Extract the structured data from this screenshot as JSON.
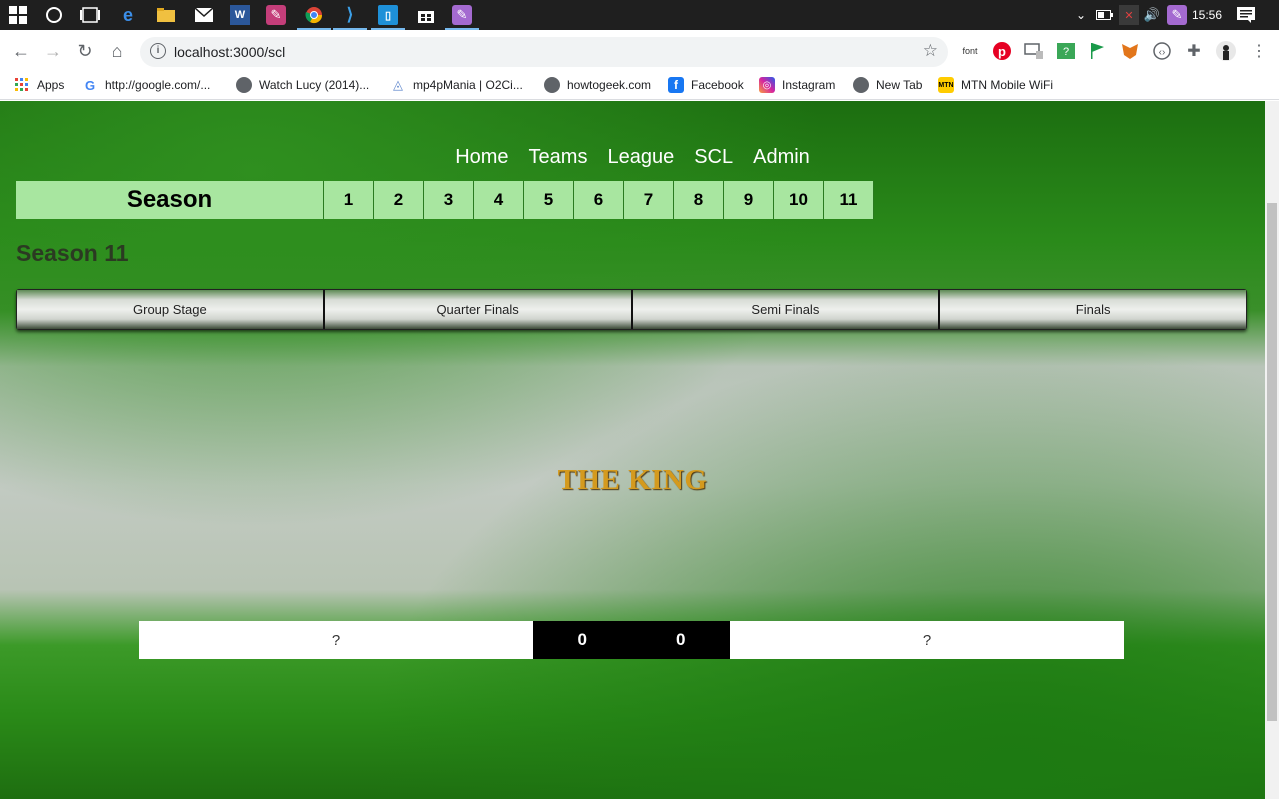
{
  "taskbar": {
    "time": "15:56",
    "tabs_hidden_text": ""
  },
  "browser": {
    "url": "localhost:3000/scl",
    "extension_font_label": "font"
  },
  "bookmarks": [
    {
      "label": "Apps",
      "icon": "apps-grid-icon"
    },
    {
      "label": "http://google.com/...",
      "icon": "google-icon"
    },
    {
      "label": "Watch Lucy (2014)...",
      "icon": "globe-icon"
    },
    {
      "label": "mp4pMania | O2Ci...",
      "icon": "mp4pmania-icon"
    },
    {
      "label": "howtogeek.com",
      "icon": "globe-icon"
    },
    {
      "label": "Facebook",
      "icon": "facebook-icon"
    },
    {
      "label": "Instagram",
      "icon": "instagram-icon"
    },
    {
      "label": "New Tab",
      "icon": "globe-icon"
    },
    {
      "label": "MTN Mobile WiFi",
      "icon": "mtn-icon"
    }
  ],
  "site": {
    "nav": [
      "Home",
      "Teams",
      "League",
      "SCL",
      "Admin"
    ],
    "season_label": "Season",
    "seasons": [
      "1",
      "2",
      "3",
      "4",
      "5",
      "6",
      "7",
      "8",
      "9",
      "10",
      "11"
    ],
    "season_title": "Season 11",
    "stages": [
      "Group Stage",
      "Quarter Finals",
      "Semi Finals",
      "Finals"
    ],
    "banner": "THE KING",
    "match": {
      "home_team": "?",
      "home_score": "0",
      "away_score": "0",
      "away_team": "?"
    }
  },
  "colors": {
    "season_button_bg": "#a8e6a0",
    "banner_gold": "#d49a1e",
    "score_bg": "#000000"
  }
}
